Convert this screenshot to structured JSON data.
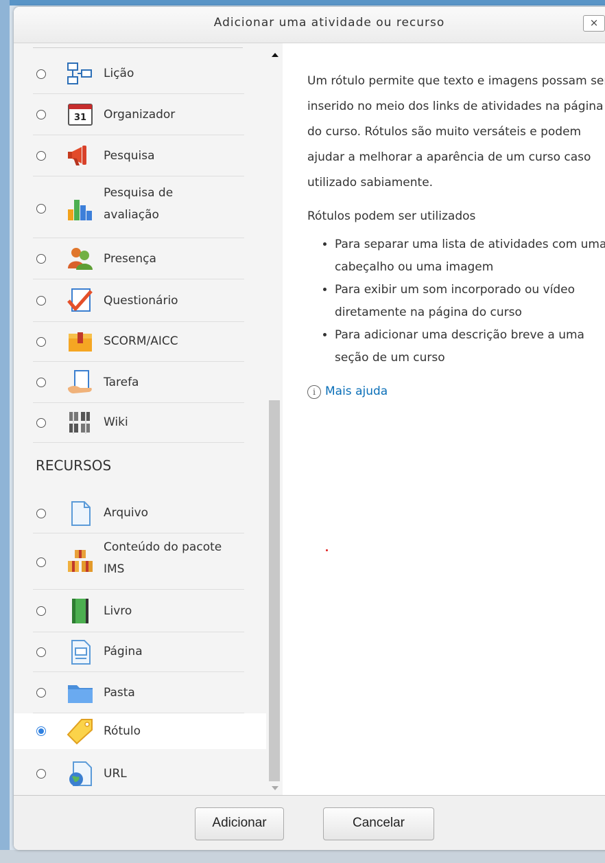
{
  "dialog": {
    "title": "Adicionar uma atividade ou recurso",
    "close_label": "×"
  },
  "activities": [
    {
      "label": "Lição",
      "icon": "lesson-icon",
      "selected": false
    },
    {
      "label": "Organizador",
      "icon": "calendar-icon",
      "selected": false
    },
    {
      "label": "Pesquisa",
      "icon": "megaphone-icon",
      "selected": false
    },
    {
      "label": "Pesquisa de avaliação",
      "icon": "bar-chart-icon",
      "selected": false
    },
    {
      "label": "Presença",
      "icon": "people-icon",
      "selected": false
    },
    {
      "label": "Questionário",
      "icon": "checkmark-document-icon",
      "selected": false
    },
    {
      "label": "SCORM/AICC",
      "icon": "package-icon",
      "selected": false
    },
    {
      "label": "Tarefa",
      "icon": "hand-document-icon",
      "selected": false
    },
    {
      "label": "Wiki",
      "icon": "wiki-icon",
      "selected": false
    }
  ],
  "resources_heading": "RECURSOS",
  "resources": [
    {
      "label": "Arquivo",
      "icon": "file-icon",
      "selected": false
    },
    {
      "label": "Conteúdo do pacote IMS",
      "icon": "ims-package-icon",
      "selected": false
    },
    {
      "label": "Livro",
      "icon": "book-icon",
      "selected": false
    },
    {
      "label": "Página",
      "icon": "page-icon",
      "selected": false
    },
    {
      "label": "Pasta",
      "icon": "folder-icon",
      "selected": false
    },
    {
      "label": "Rótulo",
      "icon": "tag-icon",
      "selected": true
    },
    {
      "label": "URL",
      "icon": "globe-document-icon",
      "selected": false
    }
  ],
  "description": {
    "paragraph1": "Um rótulo permite que texto e imagens possam ser inserido no meio dos links de atividades na página do curso. Rótulos são muito versáteis e podem ajudar a melhorar a aparência de um curso caso utilizado sabiamente.",
    "paragraph2": "Rótulos podem ser utilizados",
    "bullets": [
      "Para separar uma lista de atividades com uma cabeçalho ou uma imagem",
      "Para exibir um som incorporado ou vídeo diretamente na página do curso",
      "Para adicionar uma descrição breve a uma seção de um curso"
    ],
    "help_link": "Mais ajuda"
  },
  "buttons": {
    "add": "Adicionar",
    "cancel": "Cancelar"
  }
}
